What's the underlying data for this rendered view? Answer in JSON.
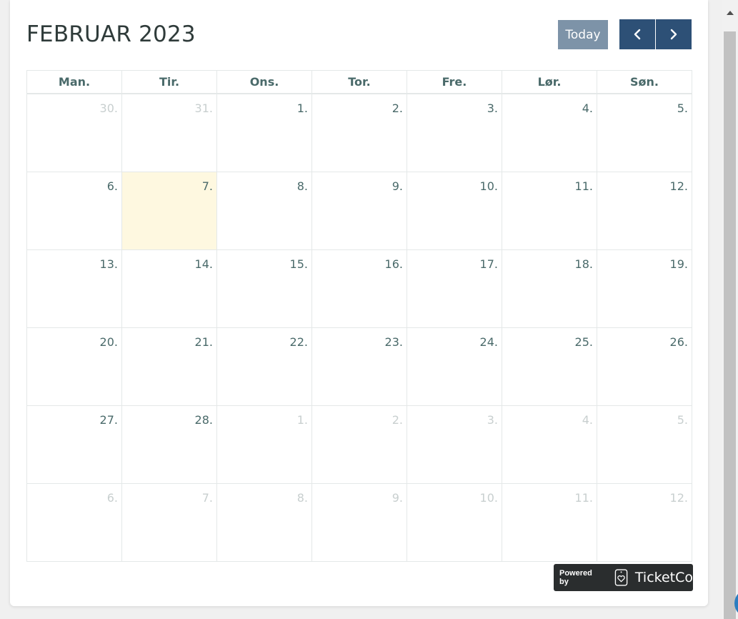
{
  "calendar": {
    "title": "FEBRUAR 2023",
    "today_label": "Today",
    "weekdays": [
      "Man.",
      "Tir.",
      "Ons.",
      "Tor.",
      "Fre.",
      "Lør.",
      "Søn."
    ],
    "weeks": [
      [
        {
          "d": "30.",
          "other": true
        },
        {
          "d": "31.",
          "other": true
        },
        {
          "d": "1."
        },
        {
          "d": "2."
        },
        {
          "d": "3."
        },
        {
          "d": "4."
        },
        {
          "d": "5."
        }
      ],
      [
        {
          "d": "6."
        },
        {
          "d": "7.",
          "today": true
        },
        {
          "d": "8."
        },
        {
          "d": "9."
        },
        {
          "d": "10."
        },
        {
          "d": "11."
        },
        {
          "d": "12."
        }
      ],
      [
        {
          "d": "13."
        },
        {
          "d": "14."
        },
        {
          "d": "15."
        },
        {
          "d": "16."
        },
        {
          "d": "17."
        },
        {
          "d": "18."
        },
        {
          "d": "19."
        }
      ],
      [
        {
          "d": "20."
        },
        {
          "d": "21."
        },
        {
          "d": "22."
        },
        {
          "d": "23."
        },
        {
          "d": "24."
        },
        {
          "d": "25."
        },
        {
          "d": "26."
        }
      ],
      [
        {
          "d": "27."
        },
        {
          "d": "28."
        },
        {
          "d": "1.",
          "other": true
        },
        {
          "d": "2.",
          "other": true
        },
        {
          "d": "3.",
          "other": true
        },
        {
          "d": "4.",
          "other": true
        },
        {
          "d": "5.",
          "other": true
        }
      ],
      [
        {
          "d": "6.",
          "other": true
        },
        {
          "d": "7.",
          "other": true
        },
        {
          "d": "8.",
          "other": true
        },
        {
          "d": "9.",
          "other": true
        },
        {
          "d": "10.",
          "other": true
        },
        {
          "d": "11.",
          "other": true
        },
        {
          "d": "12.",
          "other": true
        }
      ]
    ]
  },
  "footer": {
    "powered_by": "Powered by",
    "brand": "TicketCo"
  },
  "icons": {
    "prev": "chevron-left-icon",
    "next": "chevron-right-icon",
    "logo": "ticketco-logo-icon"
  },
  "colors": {
    "today_button": "#7d93a8",
    "nav_button": "#2d5076",
    "today_highlight": "#fef8e0",
    "text": "#4a6a6a"
  }
}
